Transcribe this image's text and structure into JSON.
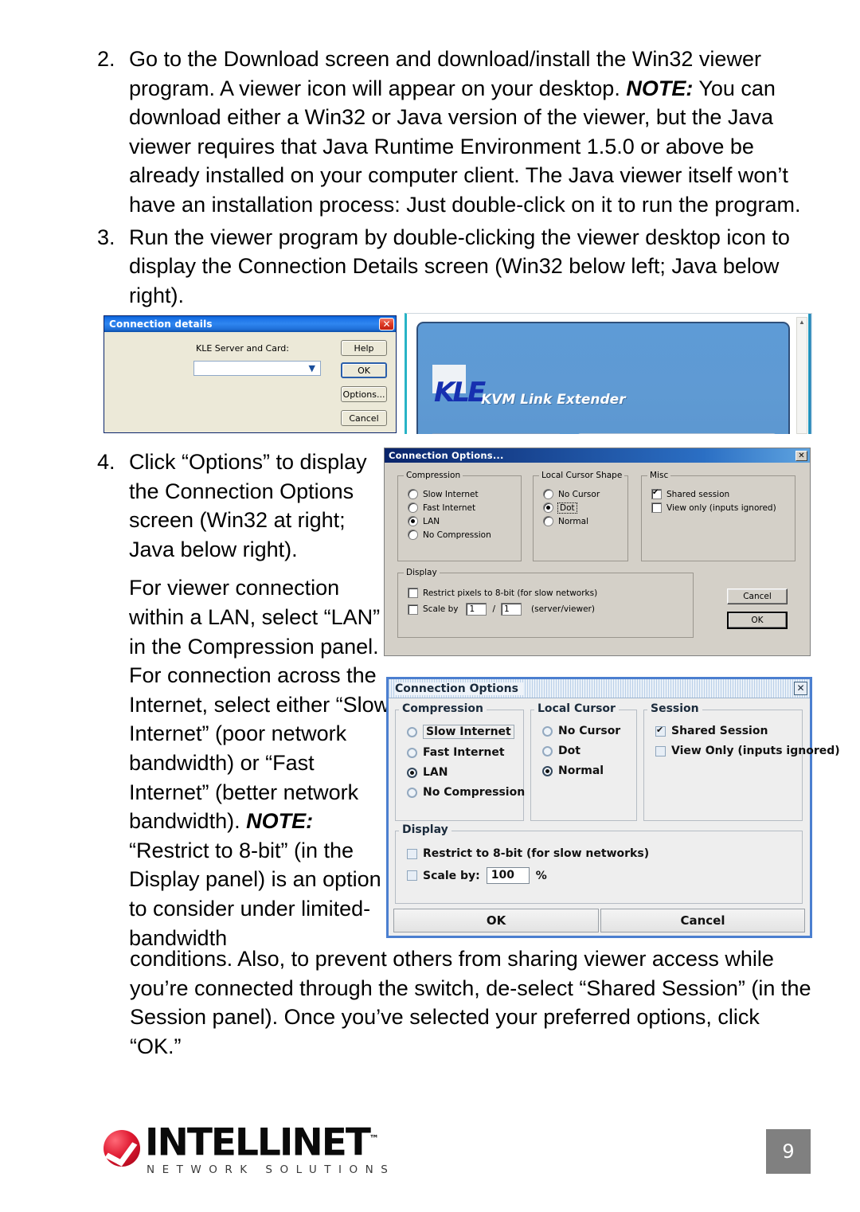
{
  "document": {
    "page_number": "9",
    "steps": [
      {
        "number": "2.",
        "text_before_note": "Go to the Download screen and download/install the Win32 viewer program. A viewer icon will appear on your desktop. ",
        "note_label": "NOTE:",
        "text_after_note": " You can download either a Win32 or Java version of the viewer, but the Java viewer requires that Java Runtime Environment 1.5.0 or above be already installed on your computer client. The Java viewer itself won’t have an installation process: Just double-click on it to run the program."
      },
      {
        "number": "3.",
        "text": "Run the viewer program by double-clicking the viewer desktop icon to display the Connection Details screen (Win32 below left; Java below right)."
      },
      {
        "number": "4.",
        "para1": "Click “Options” to display the Connection Options screen (Win32 at right; Java below right).",
        "para2_a": "For viewer connection within a LAN, select “LAN” in the Compression panel. For connection across the Internet, select either “Slow Internet” (poor network bandwidth) or “Fast Internet” (better network bandwidth). ",
        "para2_note": "NOTE:",
        "para2_b": " “Restrict to 8-bit” (in the Display panel) is an option to consider under limited-bandwidth",
        "tail": "conditions. Also, to prevent others from sharing viewer access while you’re connected through the switch, de-select “Shared Session” (in the Session panel). Once you’ve selected your preferred options, click “OK.”"
      }
    ]
  },
  "connection_details_win32": {
    "title": "Connection details",
    "close_glyph": "✕",
    "field_label": "KLE Server and Card:",
    "combo_value": "",
    "combo_arrow": "▼",
    "buttons": {
      "help": "Help",
      "ok": "OK",
      "options": "Options...",
      "cancel": "Cancel"
    }
  },
  "connection_details_java": {
    "logo_mark": "KLE",
    "logo_subtitle": "KVM Link Extender",
    "scroll_up_glyph": "▲"
  },
  "connection_options_win32": {
    "title": "Connection Options...",
    "close_glyph": "✕",
    "groups": {
      "compression": {
        "title": "Compression",
        "options": [
          {
            "label": "Slow Internet",
            "selected": false
          },
          {
            "label": "Fast Internet",
            "selected": false
          },
          {
            "label": "LAN",
            "selected": true
          },
          {
            "label": "No Compression",
            "selected": false
          }
        ]
      },
      "local_cursor_shape": {
        "title": "Local Cursor Shape",
        "options": [
          {
            "label": "No Cursor",
            "selected": false
          },
          {
            "label": "Dot",
            "selected": true
          },
          {
            "label": "Normal",
            "selected": false
          }
        ]
      },
      "misc": {
        "title": "Misc",
        "options": [
          {
            "label": "Shared session",
            "checked": true
          },
          {
            "label": "View only (inputs ignored)",
            "checked": false
          }
        ]
      },
      "display": {
        "title": "Display",
        "restrict_label": "Restrict pixels to 8-bit (for slow networks)",
        "restrict_checked": false,
        "scale_label": "Scale by",
        "scale_checked": false,
        "scale_numerator": "1",
        "scale_separator": "/",
        "scale_denominator": "1",
        "scale_suffix": "(server/viewer)"
      }
    },
    "buttons": {
      "cancel": "Cancel",
      "ok": "OK"
    }
  },
  "connection_options_java": {
    "title": "Connection Options",
    "close_glyph": "✕",
    "groups": {
      "compression": {
        "title": "Compression",
        "options": [
          {
            "label": "Slow Internet",
            "selected": false,
            "focused": true
          },
          {
            "label": "Fast Internet",
            "selected": false,
            "focused": false
          },
          {
            "label": "LAN",
            "selected": true,
            "focused": false
          },
          {
            "label": "No Compression",
            "selected": false,
            "focused": false
          }
        ]
      },
      "local_cursor": {
        "title": "Local Cursor",
        "options": [
          {
            "label": "No Cursor",
            "selected": false
          },
          {
            "label": "Dot",
            "selected": false
          },
          {
            "label": "Normal",
            "selected": true
          }
        ]
      },
      "session": {
        "title": "Session",
        "options": [
          {
            "label": "Shared Session",
            "checked": true
          },
          {
            "label": "View Only (inputs ignored)",
            "checked": false
          }
        ]
      },
      "display": {
        "title": "Display",
        "restrict_label": "Restrict to 8-bit (for slow networks)",
        "restrict_checked": false,
        "scale_label": "Scale by:",
        "scale_checked": false,
        "scale_value": "100",
        "scale_unit": "%"
      }
    },
    "buttons": {
      "ok": "OK",
      "cancel": "Cancel"
    }
  },
  "footer": {
    "brand": "INTELLINET",
    "trademark": "™",
    "tagline": "NETWORK SOLUTIONS"
  }
}
